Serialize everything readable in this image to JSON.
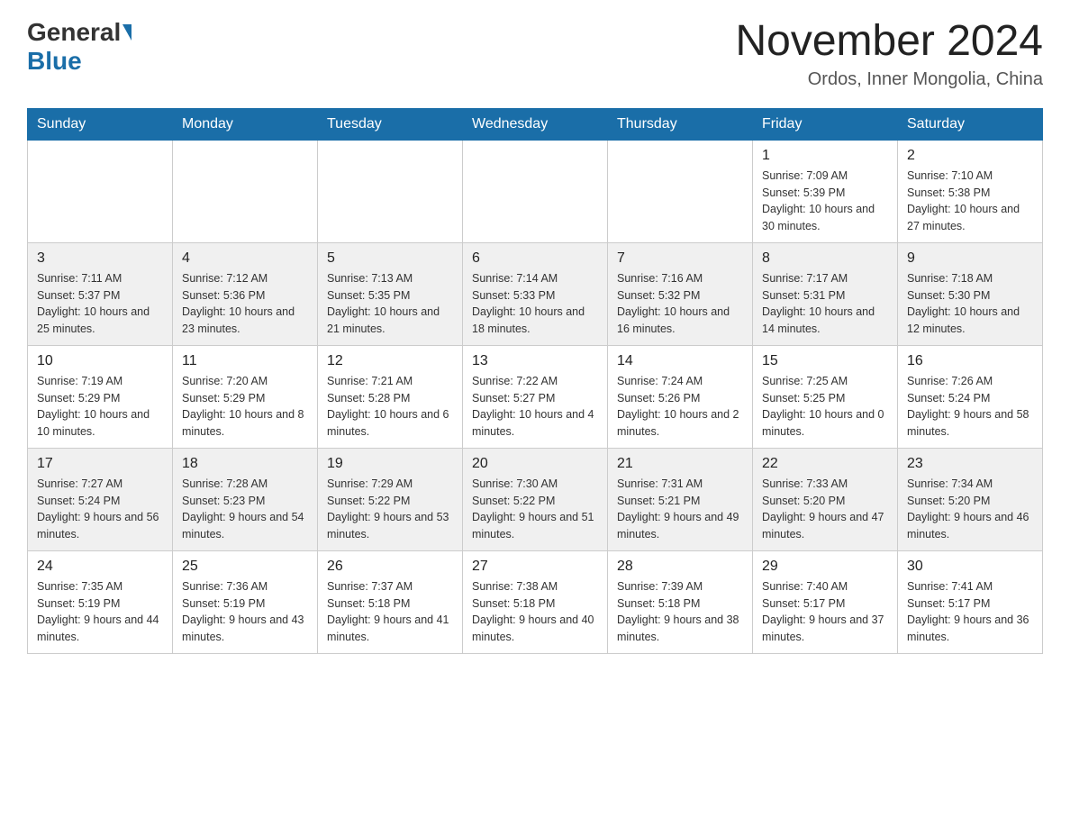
{
  "header": {
    "logo_general": "General",
    "logo_blue": "Blue",
    "month_title": "November 2024",
    "location": "Ordos, Inner Mongolia, China"
  },
  "weekdays": [
    "Sunday",
    "Monday",
    "Tuesday",
    "Wednesday",
    "Thursday",
    "Friday",
    "Saturday"
  ],
  "weeks": [
    [
      {
        "day": "",
        "sunrise": "",
        "sunset": "",
        "daylight": ""
      },
      {
        "day": "",
        "sunrise": "",
        "sunset": "",
        "daylight": ""
      },
      {
        "day": "",
        "sunrise": "",
        "sunset": "",
        "daylight": ""
      },
      {
        "day": "",
        "sunrise": "",
        "sunset": "",
        "daylight": ""
      },
      {
        "day": "",
        "sunrise": "",
        "sunset": "",
        "daylight": ""
      },
      {
        "day": "1",
        "sunrise": "Sunrise: 7:09 AM",
        "sunset": "Sunset: 5:39 PM",
        "daylight": "Daylight: 10 hours and 30 minutes."
      },
      {
        "day": "2",
        "sunrise": "Sunrise: 7:10 AM",
        "sunset": "Sunset: 5:38 PM",
        "daylight": "Daylight: 10 hours and 27 minutes."
      }
    ],
    [
      {
        "day": "3",
        "sunrise": "Sunrise: 7:11 AM",
        "sunset": "Sunset: 5:37 PM",
        "daylight": "Daylight: 10 hours and 25 minutes."
      },
      {
        "day": "4",
        "sunrise": "Sunrise: 7:12 AM",
        "sunset": "Sunset: 5:36 PM",
        "daylight": "Daylight: 10 hours and 23 minutes."
      },
      {
        "day": "5",
        "sunrise": "Sunrise: 7:13 AM",
        "sunset": "Sunset: 5:35 PM",
        "daylight": "Daylight: 10 hours and 21 minutes."
      },
      {
        "day": "6",
        "sunrise": "Sunrise: 7:14 AM",
        "sunset": "Sunset: 5:33 PM",
        "daylight": "Daylight: 10 hours and 18 minutes."
      },
      {
        "day": "7",
        "sunrise": "Sunrise: 7:16 AM",
        "sunset": "Sunset: 5:32 PM",
        "daylight": "Daylight: 10 hours and 16 minutes."
      },
      {
        "day": "8",
        "sunrise": "Sunrise: 7:17 AM",
        "sunset": "Sunset: 5:31 PM",
        "daylight": "Daylight: 10 hours and 14 minutes."
      },
      {
        "day": "9",
        "sunrise": "Sunrise: 7:18 AM",
        "sunset": "Sunset: 5:30 PM",
        "daylight": "Daylight: 10 hours and 12 minutes."
      }
    ],
    [
      {
        "day": "10",
        "sunrise": "Sunrise: 7:19 AM",
        "sunset": "Sunset: 5:29 PM",
        "daylight": "Daylight: 10 hours and 10 minutes."
      },
      {
        "day": "11",
        "sunrise": "Sunrise: 7:20 AM",
        "sunset": "Sunset: 5:29 PM",
        "daylight": "Daylight: 10 hours and 8 minutes."
      },
      {
        "day": "12",
        "sunrise": "Sunrise: 7:21 AM",
        "sunset": "Sunset: 5:28 PM",
        "daylight": "Daylight: 10 hours and 6 minutes."
      },
      {
        "day": "13",
        "sunrise": "Sunrise: 7:22 AM",
        "sunset": "Sunset: 5:27 PM",
        "daylight": "Daylight: 10 hours and 4 minutes."
      },
      {
        "day": "14",
        "sunrise": "Sunrise: 7:24 AM",
        "sunset": "Sunset: 5:26 PM",
        "daylight": "Daylight: 10 hours and 2 minutes."
      },
      {
        "day": "15",
        "sunrise": "Sunrise: 7:25 AM",
        "sunset": "Sunset: 5:25 PM",
        "daylight": "Daylight: 10 hours and 0 minutes."
      },
      {
        "day": "16",
        "sunrise": "Sunrise: 7:26 AM",
        "sunset": "Sunset: 5:24 PM",
        "daylight": "Daylight: 9 hours and 58 minutes."
      }
    ],
    [
      {
        "day": "17",
        "sunrise": "Sunrise: 7:27 AM",
        "sunset": "Sunset: 5:24 PM",
        "daylight": "Daylight: 9 hours and 56 minutes."
      },
      {
        "day": "18",
        "sunrise": "Sunrise: 7:28 AM",
        "sunset": "Sunset: 5:23 PM",
        "daylight": "Daylight: 9 hours and 54 minutes."
      },
      {
        "day": "19",
        "sunrise": "Sunrise: 7:29 AM",
        "sunset": "Sunset: 5:22 PM",
        "daylight": "Daylight: 9 hours and 53 minutes."
      },
      {
        "day": "20",
        "sunrise": "Sunrise: 7:30 AM",
        "sunset": "Sunset: 5:22 PM",
        "daylight": "Daylight: 9 hours and 51 minutes."
      },
      {
        "day": "21",
        "sunrise": "Sunrise: 7:31 AM",
        "sunset": "Sunset: 5:21 PM",
        "daylight": "Daylight: 9 hours and 49 minutes."
      },
      {
        "day": "22",
        "sunrise": "Sunrise: 7:33 AM",
        "sunset": "Sunset: 5:20 PM",
        "daylight": "Daylight: 9 hours and 47 minutes."
      },
      {
        "day": "23",
        "sunrise": "Sunrise: 7:34 AM",
        "sunset": "Sunset: 5:20 PM",
        "daylight": "Daylight: 9 hours and 46 minutes."
      }
    ],
    [
      {
        "day": "24",
        "sunrise": "Sunrise: 7:35 AM",
        "sunset": "Sunset: 5:19 PM",
        "daylight": "Daylight: 9 hours and 44 minutes."
      },
      {
        "day": "25",
        "sunrise": "Sunrise: 7:36 AM",
        "sunset": "Sunset: 5:19 PM",
        "daylight": "Daylight: 9 hours and 43 minutes."
      },
      {
        "day": "26",
        "sunrise": "Sunrise: 7:37 AM",
        "sunset": "Sunset: 5:18 PM",
        "daylight": "Daylight: 9 hours and 41 minutes."
      },
      {
        "day": "27",
        "sunrise": "Sunrise: 7:38 AM",
        "sunset": "Sunset: 5:18 PM",
        "daylight": "Daylight: 9 hours and 40 minutes."
      },
      {
        "day": "28",
        "sunrise": "Sunrise: 7:39 AM",
        "sunset": "Sunset: 5:18 PM",
        "daylight": "Daylight: 9 hours and 38 minutes."
      },
      {
        "day": "29",
        "sunrise": "Sunrise: 7:40 AM",
        "sunset": "Sunset: 5:17 PM",
        "daylight": "Daylight: 9 hours and 37 minutes."
      },
      {
        "day": "30",
        "sunrise": "Sunrise: 7:41 AM",
        "sunset": "Sunset: 5:17 PM",
        "daylight": "Daylight: 9 hours and 36 minutes."
      }
    ]
  ]
}
